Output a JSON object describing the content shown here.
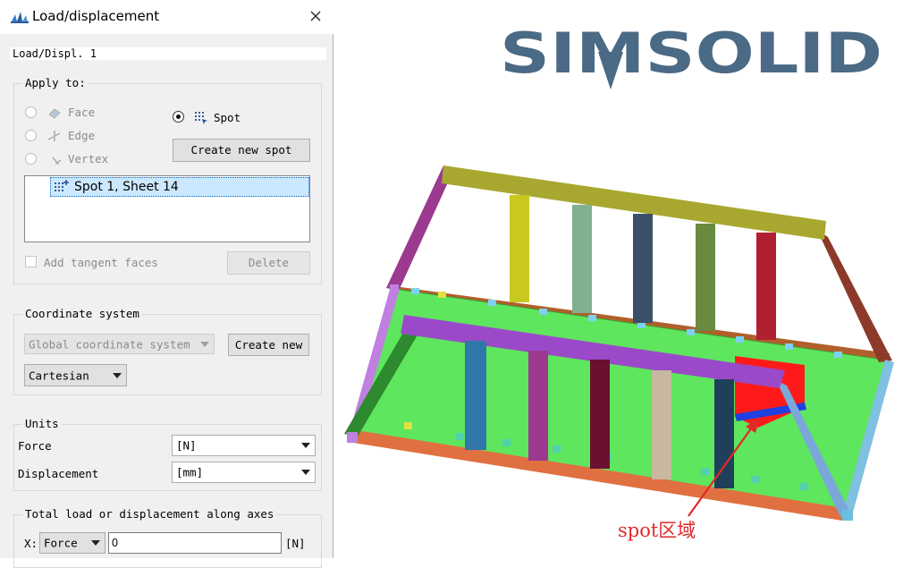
{
  "dialog": {
    "title": "Load/displacement",
    "name_value": "Load/Displ. 1",
    "apply_to": {
      "label": "Apply to:",
      "options": [
        {
          "label": "Face",
          "enabled": false,
          "selected": false
        },
        {
          "label": "Edge",
          "enabled": false,
          "selected": false
        },
        {
          "label": "Vertex",
          "enabled": false,
          "selected": false
        },
        {
          "label": "Spot",
          "enabled": true,
          "selected": true
        }
      ],
      "create_spot_label": "Create new spot",
      "list_items": [
        "Spot 1, Sheet 14"
      ],
      "add_tangent_label": "Add tangent faces",
      "delete_label": "Delete"
    },
    "coord": {
      "label": "Coordinate system",
      "system_value": "Global coordinate system",
      "create_new_label": "Create new",
      "type_value": "Cartesian"
    },
    "units": {
      "label": "Units",
      "force_label": "Force",
      "force_value": "[N]",
      "disp_label": "Displacement",
      "disp_value": "[mm]"
    },
    "total": {
      "label": "Total load or displacement along axes",
      "axis_label": "X:",
      "type_value": "Force",
      "value": "0",
      "unit": "[N]"
    }
  },
  "viewport": {
    "logo_text": "SIMSOLID",
    "annotation": "spot区域",
    "colors": {
      "logo": "#4a6a85",
      "plate": "#5ee65e",
      "spot": "#ff1a1a",
      "annotation": "#e02a2a"
    }
  }
}
